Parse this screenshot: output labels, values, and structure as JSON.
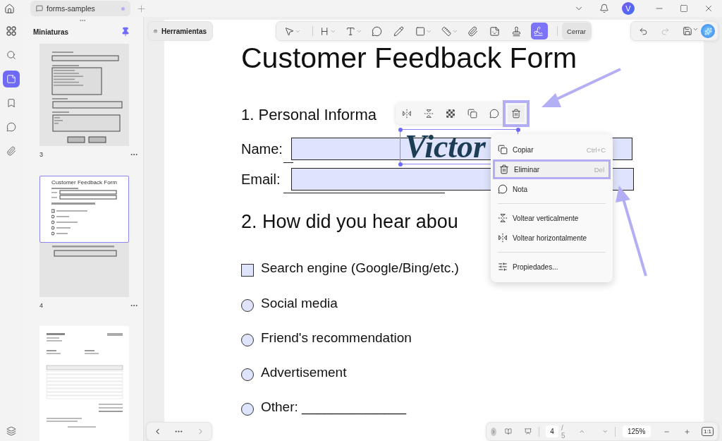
{
  "tab": {
    "title": "forms-samples",
    "unsaved": true
  },
  "account": {
    "initial": "V"
  },
  "rail": [
    {
      "kind": "apps",
      "selected": false
    },
    {
      "kind": "search",
      "selected": false
    },
    {
      "kind": "thumbnails",
      "selected": true
    },
    {
      "kind": "bookmark",
      "selected": false
    },
    {
      "kind": "comments",
      "selected": false
    },
    {
      "kind": "attachment",
      "selected": false
    }
  ],
  "thumbnails": {
    "title": "Miniaturas",
    "pinned": true,
    "pages": [
      {
        "kind": "tasks",
        "number": "3",
        "selected": false
      },
      {
        "kind": "feedback",
        "number": "4",
        "selected": true,
        "title": "Customer Feedback Form"
      },
      {
        "kind": "invoice",
        "selected": false
      }
    ]
  },
  "tools_button": "Herramientas",
  "tools": [
    {
      "kind": "select",
      "dropdown": true,
      "selected": false
    },
    {
      "kind": "heading",
      "dropdown": true,
      "selected": false
    },
    {
      "kind": "text",
      "dropdown": true,
      "selected": false
    },
    {
      "kind": "comment",
      "dropdown": false,
      "selected": false
    },
    {
      "kind": "pen",
      "dropdown": false,
      "selected": false
    },
    {
      "kind": "shape",
      "dropdown": true,
      "selected": false
    },
    {
      "kind": "measure",
      "dropdown": true,
      "selected": false
    },
    {
      "kind": "attach",
      "dropdown": false,
      "selected": false
    },
    {
      "kind": "sticker",
      "dropdown": false,
      "selected": false
    },
    {
      "kind": "stamp",
      "dropdown": false,
      "selected": false
    },
    {
      "kind": "signature",
      "dropdown": false,
      "selected": true
    }
  ],
  "close_button": "Cerrar",
  "history": {
    "undo_disabled": false,
    "redo_disabled": true
  },
  "document": {
    "title": "Customer Feedback Form",
    "section_1": "1. Personal Informa",
    "name_label": "Name:",
    "email_label": "Email:",
    "section_2": "2. How did you hear abou",
    "options": [
      {
        "kind": "checkbox",
        "label": "Search engine (Google/Bing/etc.)",
        "checked": false
      },
      {
        "kind": "radio",
        "label": "Social media",
        "checked": false
      },
      {
        "kind": "radio",
        "label": "Friend's recommendation",
        "checked": false
      },
      {
        "kind": "radio",
        "label": "Advertisement",
        "checked": false
      },
      {
        "kind": "radio",
        "label": "Other: ______________",
        "checked": false
      }
    ]
  },
  "signature": {
    "text": "Victor"
  },
  "selection_toolbar": [
    {
      "kind": "flip-h",
      "highlighted": false
    },
    {
      "kind": "flip-v",
      "highlighted": false
    },
    {
      "kind": "opacity",
      "highlighted": false
    },
    {
      "kind": "copy",
      "highlighted": false
    },
    {
      "kind": "note",
      "highlighted": false
    },
    {
      "kind": "delete",
      "highlighted": true
    }
  ],
  "context_menu": [
    {
      "kind": "copy",
      "label": "Copiar",
      "shortcut": "Ctrl+C",
      "highlighted": false
    },
    {
      "kind": "delete",
      "label": "Eliminar",
      "shortcut": "Del",
      "highlighted": true
    },
    {
      "kind": "note",
      "label": "Nota",
      "highlighted": false
    },
    {
      "kind": "divider"
    },
    {
      "kind": "flip-v",
      "label": "Voltear verticalmente",
      "highlighted": false
    },
    {
      "kind": "flip-h",
      "label": "Voltear horizontalmente",
      "highlighted": false
    },
    {
      "kind": "divider"
    },
    {
      "kind": "properties",
      "label": "Propiedades...",
      "highlighted": false
    }
  ],
  "pager": {
    "page": "4",
    "total": "/ 5",
    "zoom": "125%",
    "actual_size": "1:1"
  }
}
